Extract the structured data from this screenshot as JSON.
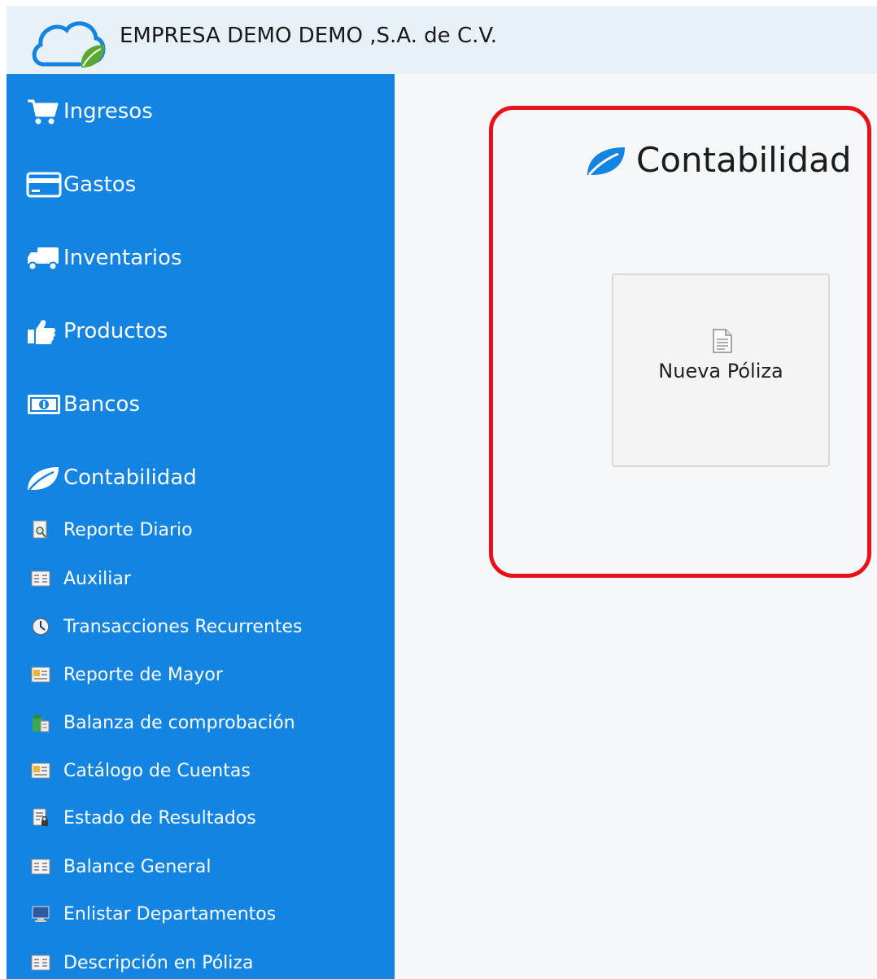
{
  "header": {
    "company_name": "EMPRESA DEMO DEMO ,S.A. de C.V.",
    "logo_icon": "cloud-leaf-logo-icon"
  },
  "sidebar": {
    "modules": [
      {
        "label": "Ingresos",
        "icon": "cart-icon"
      },
      {
        "label": "Gastos",
        "icon": "credit-card-icon"
      },
      {
        "label": "Inventarios",
        "icon": "truck-icon"
      },
      {
        "label": "Productos",
        "icon": "thumbs-up-icon"
      },
      {
        "label": "Bancos",
        "icon": "money-icon"
      },
      {
        "label": "Contabilidad",
        "icon": "leaf-icon"
      }
    ],
    "contabilidad_items": [
      {
        "label": "Reporte Diario",
        "icon": "report-search-icon"
      },
      {
        "label": "Auxiliar",
        "icon": "ledger-icon"
      },
      {
        "label": "Transacciones Recurrentes",
        "icon": "clock-icon"
      },
      {
        "label": "Reporte de Mayor",
        "icon": "report-card-icon"
      },
      {
        "label": "Balanza de comprobación",
        "icon": "building-icon"
      },
      {
        "label": "Catálogo de Cuentas",
        "icon": "report-card-icon"
      },
      {
        "label": "Estado de Resultados",
        "icon": "document-lock-icon"
      },
      {
        "label": "Balance General",
        "icon": "ledger-icon"
      },
      {
        "label": "Enlistar Departamentos",
        "icon": "monitor-icon"
      },
      {
        "label": "Descripción en Póliza",
        "icon": "ledger-icon"
      }
    ]
  },
  "main": {
    "title": "Contabilidad",
    "title_icon": "leaf-icon",
    "tiles": [
      {
        "label": "Nueva Póliza",
        "icon": "document-icon"
      }
    ]
  },
  "colors": {
    "sidebar": "#1384e1",
    "header": "#e8f0f8",
    "highlight": "#e8101c",
    "logo_green": "#5aa832"
  }
}
